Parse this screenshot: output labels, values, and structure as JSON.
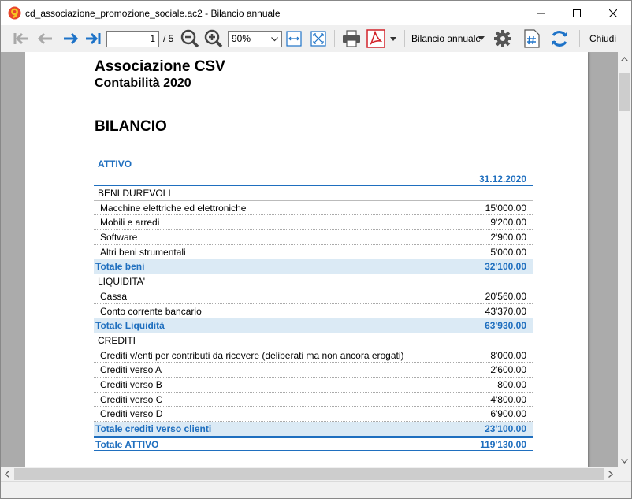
{
  "window": {
    "title": "cd_associazione_promozione_sociale.ac2 - Bilancio annuale"
  },
  "toolbar": {
    "page_current": "1",
    "page_total": "/ 5",
    "zoom": "90%",
    "report": "Bilancio annuale",
    "close_label": "Chiudi"
  },
  "colors": {
    "accent": "#1f6fbf",
    "total_row_bg": "#dbeaf5",
    "pdf_red": "#d2232a",
    "nav_blue": "#1e73c8"
  },
  "document": {
    "org": "Associazione CSV",
    "subtitle": "Contabilità 2020",
    "heading": "BILANCIO",
    "section": "ATTIVO",
    "date_header": "31.12.2020",
    "rows": [
      {
        "type": "group",
        "label": "BENI DUREVOLI",
        "value": ""
      },
      {
        "type": "item",
        "label": "Macchine elettriche ed elettroniche",
        "value": "15'000.00"
      },
      {
        "type": "item",
        "label": "Mobili e arredi",
        "value": "9'200.00"
      },
      {
        "type": "item",
        "label": "Software",
        "value": "2'900.00"
      },
      {
        "type": "item",
        "label": "Altri beni strumentali",
        "value": "5'000.00"
      },
      {
        "type": "total",
        "label": "Totale beni",
        "value": "32'100.00"
      },
      {
        "type": "group",
        "label": "LIQUIDITA'",
        "value": ""
      },
      {
        "type": "item",
        "label": "Cassa",
        "value": "20'560.00"
      },
      {
        "type": "item",
        "label": "Conto corrente bancario",
        "value": "43'370.00"
      },
      {
        "type": "total",
        "label": "Totale Liquidità",
        "value": "63'930.00"
      },
      {
        "type": "group",
        "label": "CREDITI",
        "value": ""
      },
      {
        "type": "item",
        "label": "Crediti v/enti per contributi da ricevere (deliberati ma non ancora erogati)",
        "value": "8'000.00"
      },
      {
        "type": "item",
        "label": "Crediti verso A",
        "value": "2'600.00"
      },
      {
        "type": "item",
        "label": "Crediti verso B",
        "value": "800.00"
      },
      {
        "type": "item",
        "label": "Crediti verso C",
        "value": "4'800.00"
      },
      {
        "type": "item",
        "label": "Crediti verso D",
        "value": "6'900.00"
      },
      {
        "type": "total",
        "label": "Totale crediti verso clienti",
        "value": "23'100.00"
      },
      {
        "type": "grand",
        "label": "Totale ATTIVO",
        "value": "119'130.00"
      }
    ]
  }
}
